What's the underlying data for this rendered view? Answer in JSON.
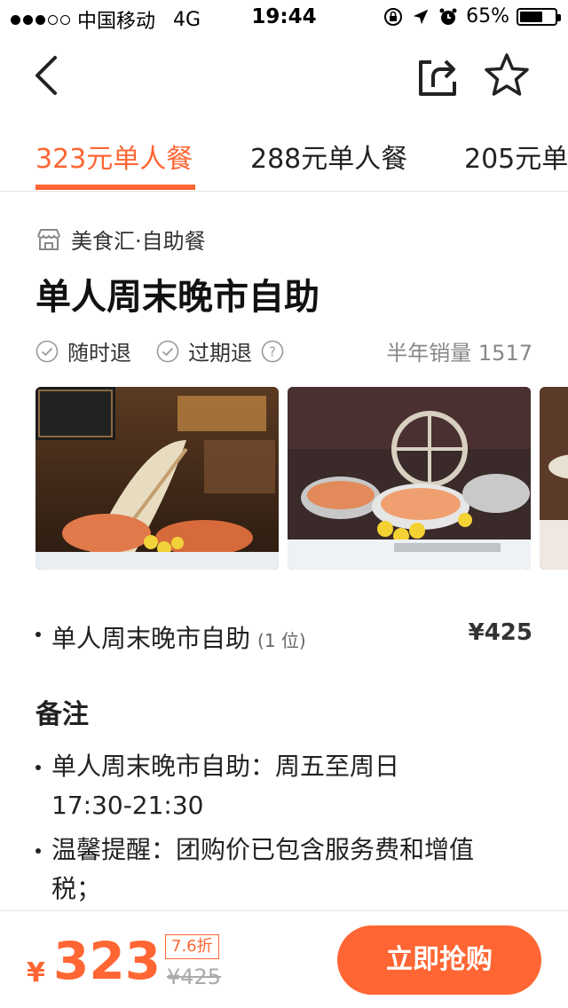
{
  "status_bar": {
    "carrier": "中国移动",
    "network": "4G",
    "time": "19:44",
    "battery_percent": "65%",
    "battery_level": 0.65
  },
  "nav": {
    "icons": [
      "back-arrow-icon",
      "share-icon",
      "star-icon"
    ]
  },
  "tabs": [
    {
      "label": "323元单人餐",
      "active": true
    },
    {
      "label": "288元单人餐",
      "active": false
    },
    {
      "label": "205元单",
      "active": false
    }
  ],
  "deal": {
    "store": "美食汇·自助餐",
    "title": "单人周末晚市自助",
    "features": [
      "随时退",
      "过期退"
    ],
    "sales_label": "半年销量 1517"
  },
  "package": {
    "name": "单人周末晚市自助",
    "quantity": "(1 位)",
    "price": "¥425"
  },
  "notes": {
    "heading": "备注",
    "items": [
      "单人周末晚市自助：周五至周日",
      "17:30-21:30",
      "温馨提醒：团购价已包含服务费和增值",
      "税；"
    ]
  },
  "purchase": {
    "currency": "¥",
    "price": "323",
    "discount": "7.6折",
    "original_price": "¥425",
    "button_label": "立即抢购"
  },
  "colors": {
    "accent": "#ff6633"
  }
}
